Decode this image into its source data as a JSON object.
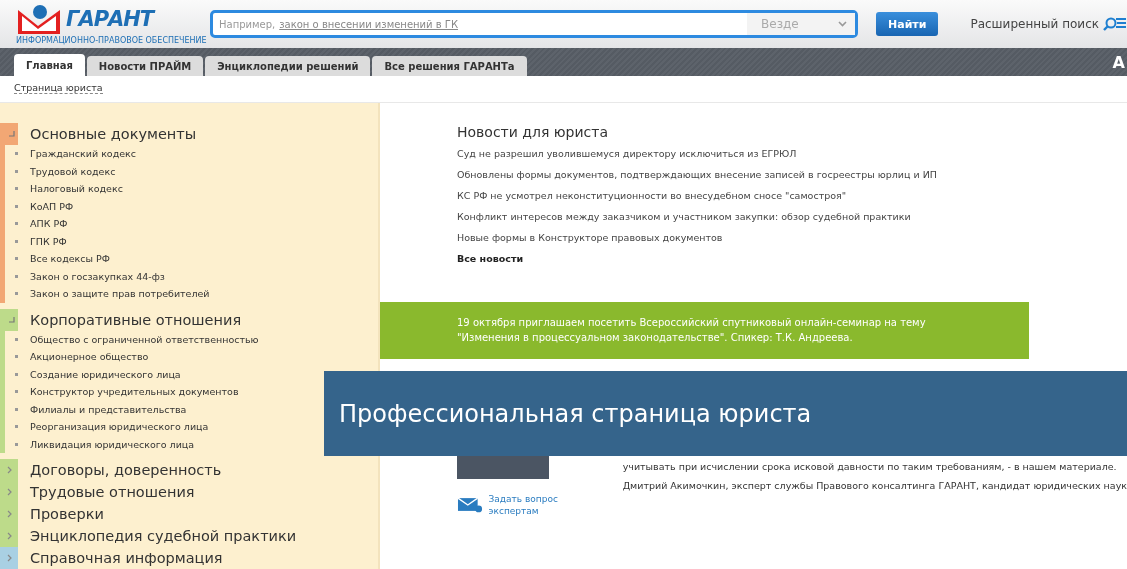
{
  "logo": {
    "name": "ГАРАНТ",
    "tagline": "ИНФОРМАЦИОННО-ПРАВОВОЕ ОБЕСПЕЧЕНИЕ"
  },
  "search": {
    "hint": "Например,",
    "example": "закон о внесении изменений в ГК",
    "scope": "Везде",
    "button": "Найти",
    "advanced": "Расширенный поиск"
  },
  "tabs": [
    {
      "label": "Главная",
      "selected": true
    },
    {
      "label": "Новости ПРАЙМ",
      "selected": false
    },
    {
      "label": "Энциклопедии решений",
      "selected": false
    },
    {
      "label": "Все решения ГАРАНТа",
      "selected": false
    }
  ],
  "tabbar_edge_text": "А",
  "breadcrumb": "Страница юриста",
  "sidebar": {
    "sections": [
      {
        "title": "Основные документы",
        "expanded": true,
        "color": "#f2a774",
        "children": [
          "Гражданский кодекс",
          "Трудовой кодекс",
          "Налоговый кодекс",
          "КоАП РФ",
          "АПК РФ",
          "ГПК РФ",
          "Все кодексы РФ",
          "Закон о госзакупках 44-фз",
          "Закон о защите прав потребителей"
        ]
      },
      {
        "title": "Корпоративные отношения",
        "expanded": true,
        "color": "#bddb8a",
        "children": [
          "Общество с ограниченной ответственностью",
          "Акционерное общество",
          "Создание юридического лица",
          "Конструктор учредительных документов",
          "Филиалы и представительства",
          "Реорганизация юридического лица",
          "Ликвидация юридического лица"
        ]
      },
      {
        "title": "Договоры, доверенность",
        "expanded": false,
        "color": "#bddb8a"
      },
      {
        "title": "Трудовые отношения",
        "expanded": false,
        "color": "#bddb8a"
      },
      {
        "title": "Проверки",
        "expanded": false,
        "color": "#bddb8a"
      },
      {
        "title": "Энциклопедия судебной практики",
        "expanded": false,
        "color": "#bddb8a"
      },
      {
        "title": "Справочная информация",
        "expanded": false,
        "color": "#a9d0e3"
      }
    ]
  },
  "news": {
    "title": "Новости для юриста",
    "items": [
      "Суд не разрешил уволившемуся директору исключиться из ЕГРЮЛ",
      "Обновлены формы документов, подтверждающих внесение записей в госреестры юрлиц и ИП",
      "КС РФ не усмотрел неконституционности во внесудебном сносе \"самостроя\"",
      "Конфликт интересов между заказчиком и участником закупки: обзор судебной практики",
      "Новые формы в Конструкторе правовых документов"
    ],
    "all": "Все новости"
  },
  "promo": "19 октября приглашаем посетить Всероссийский спутниковый онлайн-семинар на тему \"Изменения в процессуальном законодательстве\". Спикер: Т.К. Андреева.",
  "recommend": {
    "text_tail": "учитывать при исчислении срока исковой давности по таким требованиям, - в нашем материале.",
    "author": "Дмитрий Акимочкин, эксперт службы Правового консалтинга ГАРАНТ, кандидат юридических наук",
    "ask": "Задать вопрос экспертам"
  },
  "overlay_title": "Профессиональная страница юриста"
}
